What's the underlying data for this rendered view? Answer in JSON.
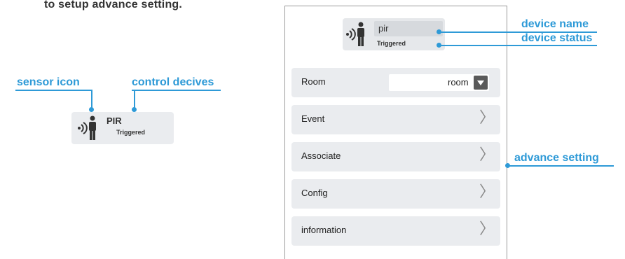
{
  "top_text": "to setup advance setting.",
  "callouts": {
    "sensor_icon": "sensor icon",
    "control_devices": "control decives",
    "device_name": "device name",
    "device_status": "device status",
    "advance_setting": "advance setting"
  },
  "card": {
    "name": "PIR",
    "status": "Triggered",
    "icon": "pir-sensor-icon"
  },
  "device": {
    "name": "pir",
    "status": "Triggered",
    "icon": "pir-sensor-icon"
  },
  "rows": {
    "room": {
      "label": "Room",
      "value": "room"
    },
    "event": {
      "label": "Event"
    },
    "associate": {
      "label": "Associate"
    },
    "config": {
      "label": "Config"
    },
    "information": {
      "label": "information"
    }
  },
  "chevron": "〉",
  "colors": {
    "accent": "#2e9ad7",
    "card_bg": "#eaecef",
    "text": "#222222"
  }
}
